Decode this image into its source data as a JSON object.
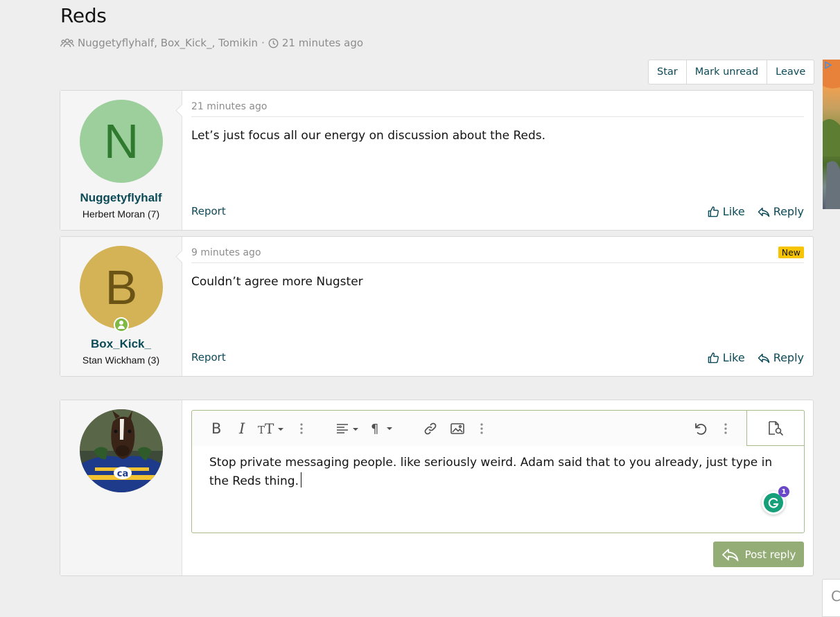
{
  "thread": {
    "title": "Reds",
    "participants": "Nuggetyflyhalf, Box_Kick_, Tomikin",
    "separator": "·",
    "time": "21 minutes ago"
  },
  "actions": {
    "star": "Star",
    "mark_unread": "Mark unread",
    "leave": "Leave"
  },
  "messages": [
    {
      "avatar_letter": "N",
      "avatar_bg": "#9ccf9b",
      "avatar_fg": "#2f7a2f",
      "username": "Nuggetyflyhalf",
      "user_title": "Herbert Moran (7)",
      "timestamp": "21 minutes ago",
      "text": "Let’s just focus all our energy on discussion about the Reds.",
      "report": "Report",
      "like": "Like",
      "reply": "Reply"
    },
    {
      "avatar_letter": "B",
      "avatar_bg": "#d3b356",
      "avatar_fg": "#6a5314",
      "username": "Box_Kick_",
      "user_title": "Stan Wickham (3)",
      "timestamp": "9 minutes ago",
      "badge": "New",
      "text": "Couldn’t agree more Nugster",
      "report": "Report",
      "like": "Like",
      "reply": "Reply"
    }
  ],
  "editor": {
    "text": "Stop private messaging people. like seriously weird. Adam said that to you already, just type in the Reds thing.",
    "grammarly_count": "1",
    "post_reply": "Post reply"
  },
  "side_stub_letter": "C",
  "colors": {
    "link": "#0b4a57",
    "post_button": "#94ad76",
    "new_badge": "#f6c400"
  }
}
